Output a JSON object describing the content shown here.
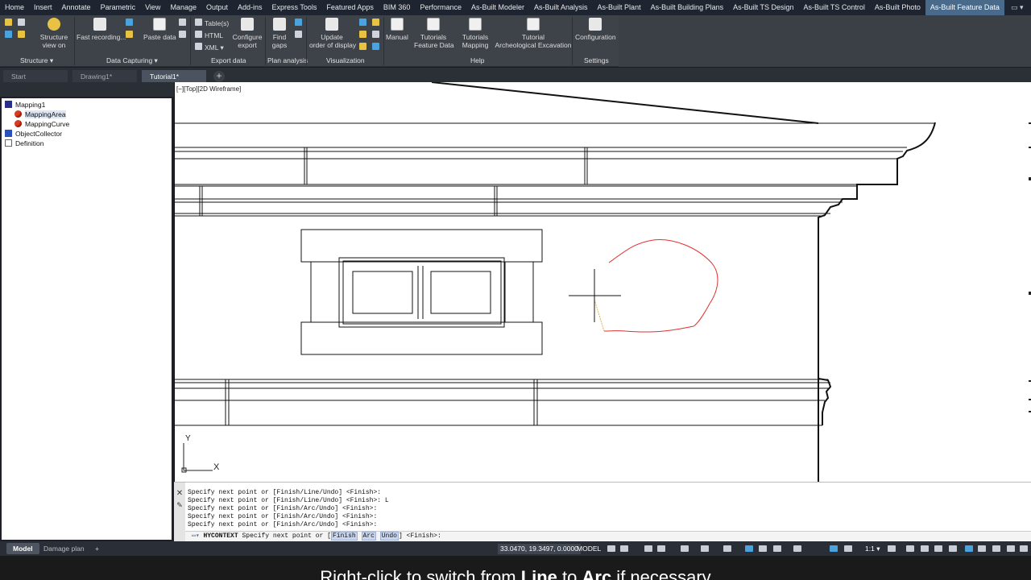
{
  "menu_tabs": [
    "Home",
    "Insert",
    "Annotate",
    "Parametric",
    "View",
    "Manage",
    "Output",
    "Add-ins",
    "Express Tools",
    "Featured Apps",
    "BIM 360",
    "Performance",
    "As-Built Modeler",
    "As-Built Analysis",
    "As-Built Plant",
    "As-Built Building Plans",
    "As-Built TS Design",
    "As-Built TS Control",
    "As-Built Photo",
    "As-Built Feature Data"
  ],
  "active_menu_tab": "As-Built Feature Data",
  "ribbon": {
    "structure_view_on": "Structure\nview on",
    "fast_recording": "Fast recording...",
    "paste_data": "Paste data",
    "tables": "Table(s)",
    "html": "HTML",
    "xml": "XML",
    "configure_export": "Configure\nexport",
    "find_gaps": "Find\ngaps",
    "update_order": "Update\norder of display",
    "manual": "Manual",
    "tutorials_feature_data": "Tutorials\nFeature Data",
    "tutorials_mapping": "Tutorials\nMapping",
    "tutorial_arch": "Tutorial\nArcheological Excavation",
    "configuration": "Configuration",
    "groups": {
      "structure": "Structure",
      "data_capturing": "Data Capturing",
      "export_data": "Export data",
      "plan_analysis": "Plan analysis",
      "visualization": "Visualization",
      "help": "Help",
      "settings": "Settings"
    }
  },
  "file_tabs": [
    "Start",
    "Drawing1*",
    "Tutorial1*"
  ],
  "active_file_tab": "Tutorial1*",
  "tree": {
    "root": "Mapping1",
    "children": [
      "MappingArea",
      "MappingCurve"
    ],
    "object_collector": "ObjectCollector",
    "definition": "Definition"
  },
  "viewport_label": "[−][Top][2D Wireframe]",
  "command_history": [
    "Specify next point or [Finish/Line/Undo] <Finish>:",
    "Specify next point or [Finish/Line/Undo] <Finish>: L",
    "Specify next point or [Finish/Arc/Undo] <Finish>:",
    "Specify next point or [Finish/Arc/Undo] <Finish>:",
    "Specify next point or [Finish/Arc/Undo] <Finish>:"
  ],
  "command_line": {
    "command": "HYCONTEXT",
    "prompt": "Specify next point or [",
    "kw_finish": "Finish",
    "kw_arc": "Arc",
    "kw_undo": "Undo",
    "suffix": "] <Finish>:"
  },
  "status": {
    "model_tab": "Model",
    "damage_plan_tab": "Damage plan",
    "coordinates": "33.0470, 19.3497, 0.0000",
    "model_button": "MODEL",
    "scale": "1:1"
  },
  "subtitle": "Right-click to switch from Line to Arc if necessary",
  "ucs": {
    "x_label": "X",
    "y_label": "Y"
  },
  "colors": {
    "accent_tab": "#4a6a8c",
    "curve": "#e03030",
    "canvas": "#ffffff"
  }
}
